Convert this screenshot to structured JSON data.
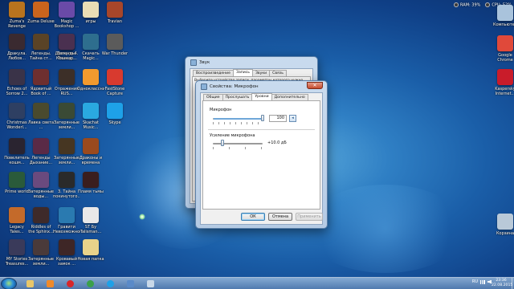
{
  "gadget": {
    "ram": "RAM: 39%",
    "cpu": "CPU: 52%"
  },
  "desktop_icons": [
    {
      "label": "Zuma's Revenge",
      "color": "#b8731e"
    },
    {
      "label": "Zuma Deluxe",
      "color": "#c9641d"
    },
    {
      "label": "Magic Bookshop ...",
      "color": "#6a4aa8"
    },
    {
      "label": "игры",
      "color": "#e9ddb5"
    },
    {
      "label": "Travian",
      "color": "#a8462a"
    },
    {
      "label": "Компьютер",
      "color": "#a9c3dc"
    },
    {
      "label": "Дракула. Любов...",
      "color": "#3a2a30"
    },
    {
      "label": "Легенды. Тайна ст...",
      "color": "#5a4326"
    },
    {
      "label": "Дракула 4. Тень д...",
      "color": "#2a2a3a"
    },
    {
      "label": "Легенды. Кошмар...",
      "color": "#4a3050"
    },
    {
      "label": "Скачать Magic...",
      "color": "#2e6e8e"
    },
    {
      "label": "War Thunder",
      "color": "#5b5b5b"
    },
    {
      "label": "Google Chrome",
      "color": "#e0493a"
    },
    {
      "label": "Echoes of Sorrow 2...",
      "color": "#3a3348"
    },
    {
      "label": "Ядовитый Book of ...",
      "color": "#6e2f2f"
    },
    {
      "label": "Отражения RUS...",
      "color": "#3c2f28"
    },
    {
      "label": "Одноклассники",
      "color": "#f29a2e"
    },
    {
      "label": "FastStone Capture",
      "color": "#d83a2f"
    },
    {
      "label": "Kaspersky Internet...",
      "color": "#c91c2a"
    },
    {
      "label": "Christmas Wonderl...",
      "color": "#2e3f62"
    },
    {
      "label": "Лавка света ...",
      "color": "#4a4a2e"
    },
    {
      "label": "Затерянные земли...",
      "color": "#3a4a35"
    },
    {
      "label": "Skachat Music...",
      "color": "#2aa9e0"
    },
    {
      "label": "Skype",
      "color": "#1ea1e8"
    },
    {
      "label": "Повелитель кошм...",
      "color": "#2a2430"
    },
    {
      "label": "Легенды Дыхание...",
      "color": "#5a2a46"
    },
    {
      "label": "Затерянные земли...",
      "color": "#463622"
    },
    {
      "label": "Драконы и времена",
      "color": "#9a4a1e"
    },
    {
      "label": "Пламя тьмы",
      "color": "#3a1e1e"
    },
    {
      "label": "Затерянные воды...",
      "color": "#6a4a7e"
    },
    {
      "label": "3. Тайна покинутого...",
      "color": "#2a2a2a"
    },
    {
      "label": "Prime world",
      "color": "#2a5a3a"
    },
    {
      "label": "Legacy Tales...",
      "color": "#c46a2a"
    },
    {
      "label": "Riddles of the Sphinx...",
      "color": "#3e2a2a"
    },
    {
      "label": "Гравити Невозможное...",
      "color": "#2a7ab0"
    },
    {
      "label": "ST Бу Talisman...",
      "color": "#e8e8e8"
    },
    {
      "label": "Корзина",
      "color": "#b9c9d8"
    },
    {
      "label": "MY Stories Treasures...",
      "color": "#3a3a5a"
    },
    {
      "label": "Затерянные земли...",
      "color": "#4a3a3a"
    },
    {
      "label": "Кровавый замок ...",
      "color": "#3e2626"
    },
    {
      "label": "Новая папка",
      "color": "#e9d38a"
    }
  ],
  "sound_window": {
    "title": "Звук",
    "tabs": [
      "Воспроизведение",
      "Запись",
      "Звуки",
      "Связь"
    ],
    "active_tab": "Запись",
    "hint": "Выберите устройство записи, параметры которого нужно"
  },
  "mic_window": {
    "title": "Свойства: Микрофон",
    "tabs": [
      "Общие",
      "Прослушать",
      "Уровни",
      "Дополнительно"
    ],
    "active_tab": "Уровни",
    "mic_label": "Микрофон",
    "mic_level": 100,
    "mic_value_text": "100",
    "boost_label": "Усиление микрофона",
    "boost_value": "+10.0 дБ",
    "ok_label": "ОК",
    "cancel_label": "Отмена",
    "apply_label": "Применить"
  },
  "taskbar": {
    "pinned": [
      {
        "name": "explorer",
        "color": "#e9c76a"
      },
      {
        "name": "media-player",
        "color": "#f08a2a"
      },
      {
        "name": "opera",
        "color": "#d8262a"
      },
      {
        "name": "chrome",
        "color": "#3aa04a"
      },
      {
        "name": "skype",
        "color": "#1ea1e8"
      },
      {
        "name": "photos",
        "color": "#5a8ac8"
      },
      {
        "name": "speaker",
        "color": "#c8d8e8"
      }
    ],
    "language": "RU",
    "time": "23:36",
    "date": "22.08.2015"
  }
}
